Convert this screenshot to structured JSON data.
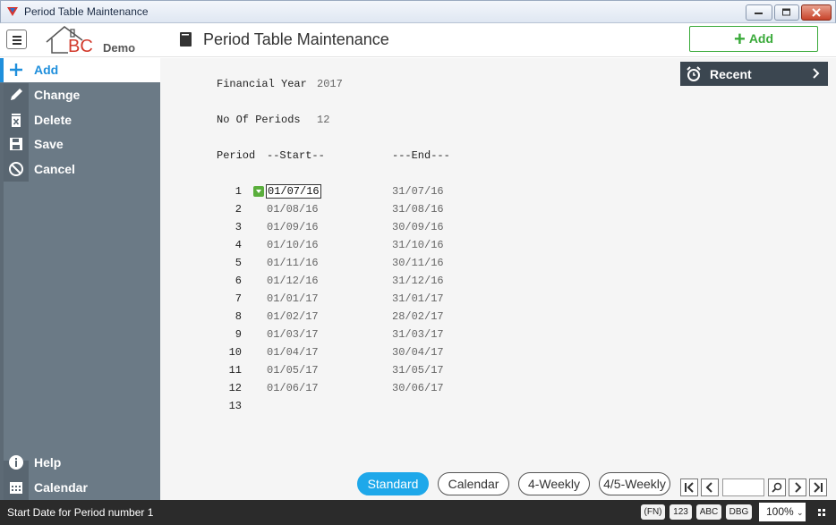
{
  "window": {
    "title": "Period Table Maintenance"
  },
  "header": {
    "company": "Demo",
    "logo_text": "BC",
    "page_title": "Period Table Maintenance",
    "add_label": "Add"
  },
  "sidebar": {
    "items": [
      {
        "label": "Add",
        "icon": "plus-icon"
      },
      {
        "label": "Change",
        "icon": "pencil-icon"
      },
      {
        "label": "Delete",
        "icon": "trash-icon"
      },
      {
        "label": "Save",
        "icon": "floppy-icon"
      },
      {
        "label": "Cancel",
        "icon": "cancel-icon"
      }
    ],
    "bottom": [
      {
        "label": "Help",
        "icon": "info-icon"
      },
      {
        "label": "Calendar",
        "icon": "calendar-icon"
      }
    ]
  },
  "form": {
    "financial_year_label": "Financial Year",
    "financial_year": "2017",
    "num_periods_label": "No Of Periods",
    "num_periods": "12",
    "col_period": "Period",
    "col_start": "--Start--",
    "col_end": "---End---",
    "periods": [
      {
        "num": "1",
        "start": "01/07/16",
        "end": "31/07/16"
      },
      {
        "num": "2",
        "start": "01/08/16",
        "end": "31/08/16"
      },
      {
        "num": "3",
        "start": "01/09/16",
        "end": "30/09/16"
      },
      {
        "num": "4",
        "start": "01/10/16",
        "end": "31/10/16"
      },
      {
        "num": "5",
        "start": "01/11/16",
        "end": "30/11/16"
      },
      {
        "num": "6",
        "start": "01/12/16",
        "end": "31/12/16"
      },
      {
        "num": "7",
        "start": "01/01/17",
        "end": "31/01/17"
      },
      {
        "num": "8",
        "start": "01/02/17",
        "end": "28/02/17"
      },
      {
        "num": "9",
        "start": "01/03/17",
        "end": "31/03/17"
      },
      {
        "num": "10",
        "start": "01/04/17",
        "end": "30/04/17"
      },
      {
        "num": "11",
        "start": "01/05/17",
        "end": "31/05/17"
      },
      {
        "num": "12",
        "start": "01/06/17",
        "end": "30/06/17"
      },
      {
        "num": "13",
        "start": "",
        "end": ""
      }
    ]
  },
  "recent": {
    "label": "Recent"
  },
  "modes": [
    {
      "label": "Standard",
      "active": true
    },
    {
      "label": "Calendar",
      "active": false
    },
    {
      "label": "4-Weekly",
      "active": false
    },
    {
      "label": "4/5-Weekly",
      "active": false
    }
  ],
  "status": {
    "text": "Start Date for Period number 1",
    "tags": [
      "(FN)",
      "123",
      "ABC",
      "DBG"
    ],
    "zoom": "100%"
  },
  "colors": {
    "sidebar": "#6b7a86",
    "accent_blue": "#1f8fdc",
    "accent_green": "#3aaa3a",
    "mode_active": "#1ea8ea"
  }
}
